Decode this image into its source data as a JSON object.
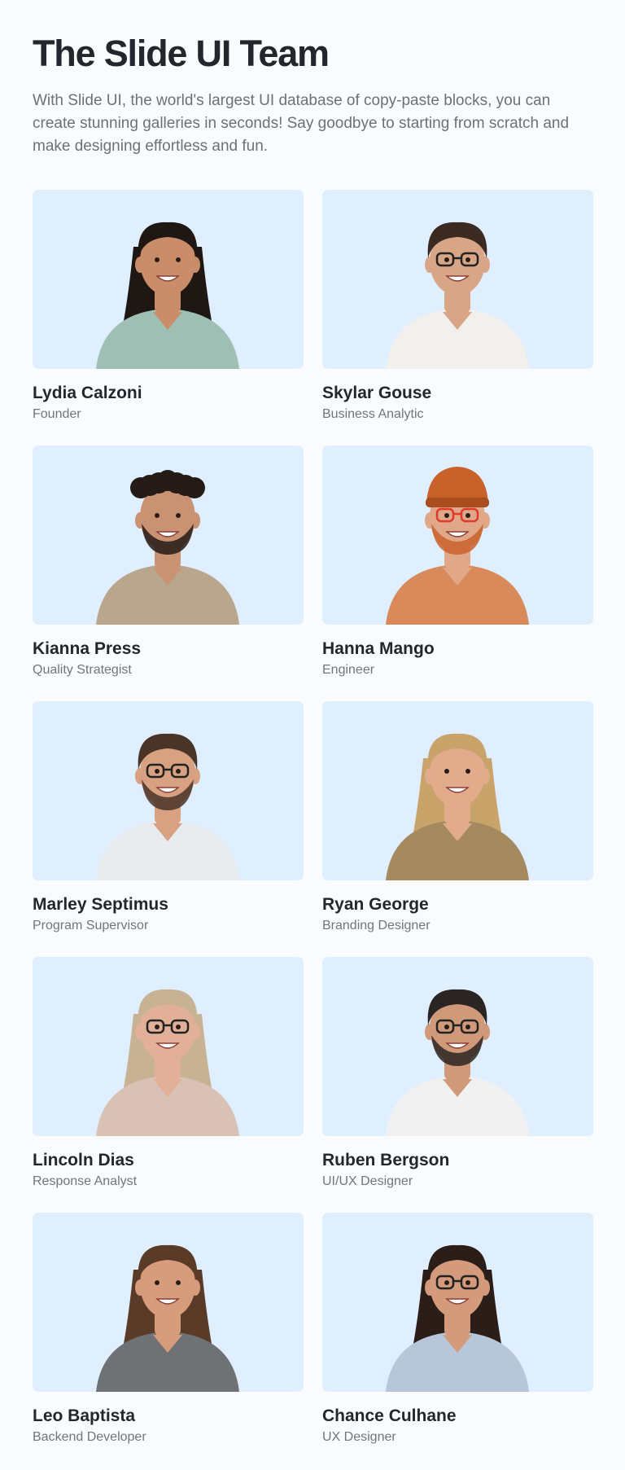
{
  "header": {
    "title": "The Slide UI Team",
    "description": "With Slide UI, the world's largest UI database of copy-paste blocks, you can create stunning galleries in seconds! Say goodbye to starting from scratch and make designing effortless and fun."
  },
  "colors": {
    "page_background": "#fafbfc",
    "photo_background": "#e0efff",
    "title": "#23272d",
    "muted": "#6b7178"
  },
  "team": [
    {
      "name": "Lydia Calzoni",
      "role": "Founder",
      "skin": "#c98d6a",
      "hair": "#1f1714",
      "shirt": "#9fbfb4",
      "hair_style": "long",
      "glasses": false,
      "hat": false,
      "beard": false
    },
    {
      "name": "Skylar Gouse",
      "role": "Business Analytic",
      "skin": "#d9a587",
      "hair": "#3a2a22",
      "shirt": "#f2f0ec",
      "hair_style": "short",
      "glasses": true,
      "hat": false,
      "beard": false
    },
    {
      "name": "Kianna Press",
      "role": "Quality Strategist",
      "skin": "#c99373",
      "hair": "#241a16",
      "shirt": "#b9a68c",
      "hair_style": "curly",
      "glasses": false,
      "hat": false,
      "beard": true
    },
    {
      "name": "Hanna Mango",
      "role": "Engineer",
      "skin": "#e0a888",
      "hair": "#c9622a",
      "shirt": "#d98a5a",
      "hair_style": "short",
      "glasses": true,
      "hat": true,
      "beard": true
    },
    {
      "name": "Marley Septimus",
      "role": "Program Supervisor",
      "skin": "#d8a282",
      "hair": "#4a3428",
      "shirt": "#e9ecef",
      "hair_style": "short",
      "glasses": true,
      "hat": false,
      "beard": true
    },
    {
      "name": "Ryan George",
      "role": "Branding Designer",
      "skin": "#e1ab8c",
      "hair": "#c9a46a",
      "shirt": "#a58a60",
      "hair_style": "long",
      "glasses": false,
      "hat": false,
      "beard": false
    },
    {
      "name": "Lincoln Dias",
      "role": "Response Analyst",
      "skin": "#e2b098",
      "hair": "#c8b294",
      "shirt": "#d9c2b5",
      "hair_style": "long",
      "glasses": true,
      "hat": false,
      "beard": false
    },
    {
      "name": "Ruben Bergson",
      "role": "UI/UX Designer",
      "skin": "#d0997a",
      "hair": "#2a2522",
      "shirt": "#f1f1f1",
      "hair_style": "short",
      "glasses": true,
      "hat": false,
      "beard": true
    },
    {
      "name": "Leo Baptista",
      "role": "Backend Developer",
      "skin": "#d79c7c",
      "hair": "#5a3b28",
      "shirt": "#6f7275",
      "hair_style": "long",
      "glasses": false,
      "hat": false,
      "beard": false
    },
    {
      "name": "Chance Culhane",
      "role": "UX Designer",
      "skin": "#d39a7b",
      "hair": "#2b1d18",
      "shirt": "#b7c7d9",
      "hair_style": "long",
      "glasses": true,
      "hat": false,
      "beard": false
    }
  ]
}
